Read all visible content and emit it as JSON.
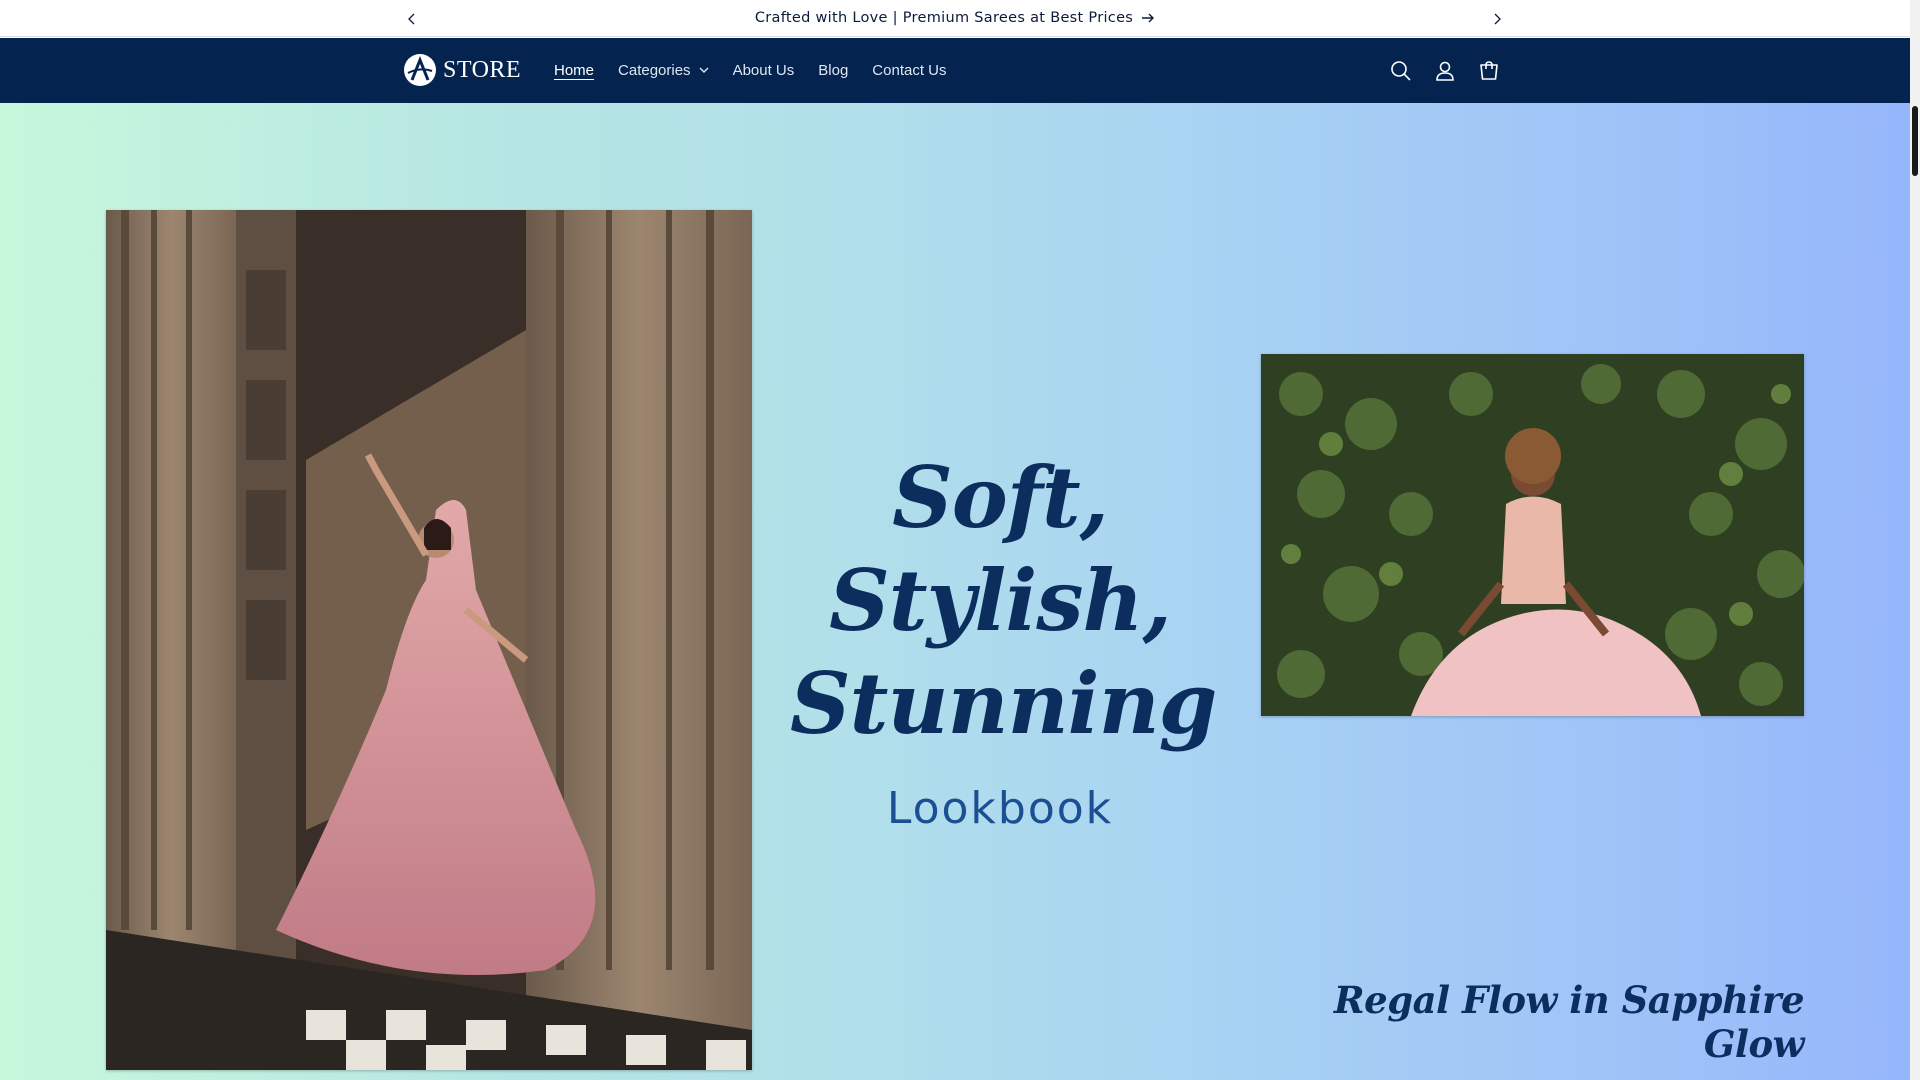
{
  "announcement": {
    "text": "Crafted with Love | Premium Sarees at Best Prices"
  },
  "header": {
    "logo_text": "STORE",
    "nav": [
      {
        "label": "Home",
        "active": true
      },
      {
        "label": "Categories",
        "has_dropdown": true
      },
      {
        "label": "About Us"
      },
      {
        "label": "Blog"
      },
      {
        "label": "Contact Us"
      }
    ],
    "icons": [
      "search-icon",
      "account-icon",
      "cart-icon"
    ]
  },
  "hero": {
    "headline_line1": "Soft,",
    "headline_line2": "Stylish,",
    "headline_line3": "Stunning",
    "subheading": "Lookbook",
    "tagline": "Regal Flow in Sapphire Glow",
    "images": [
      "woman-in-pink-gown-at-stone-doorway",
      "woman-in-pink-dress-against-ivy-wall"
    ]
  },
  "colors": {
    "header_bg": "#04244f",
    "headline": "#0c2e5f",
    "subheading": "#1c4e93",
    "gradient_start": "#c7f8dc",
    "gradient_end": "#96b6fb"
  }
}
